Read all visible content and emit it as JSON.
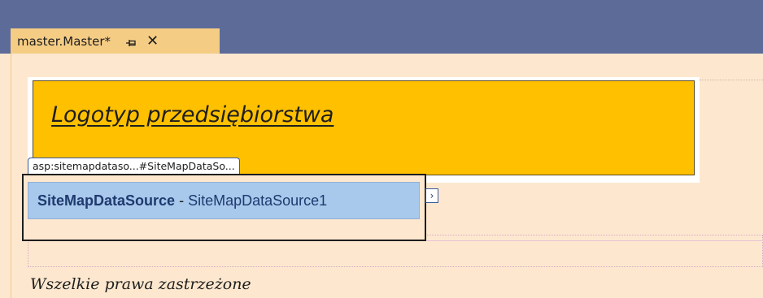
{
  "tab": {
    "title": "master.Master*",
    "pin_icon": "pin-icon",
    "close_icon": "close-icon",
    "close_glyph": "✕"
  },
  "designer": {
    "logo_text": "Logotyp przedsiębiorstwa",
    "smart_tag_label": "asp:sitemapdataso...#SiteMapDataSo...",
    "control": {
      "type_name": "SiteMapDataSource",
      "separator": "-",
      "id": "SiteMapDataSource1"
    },
    "tasks_glyph": "›",
    "footer_text": "Wszelkie prawa zastrzeżone"
  },
  "colors": {
    "tabstrip": "#5d6b99",
    "active_tab": "#f5cc84",
    "canvas": "#fde8cf",
    "logo_box": "#ffc000",
    "control_fill": "#a8c8ec"
  }
}
